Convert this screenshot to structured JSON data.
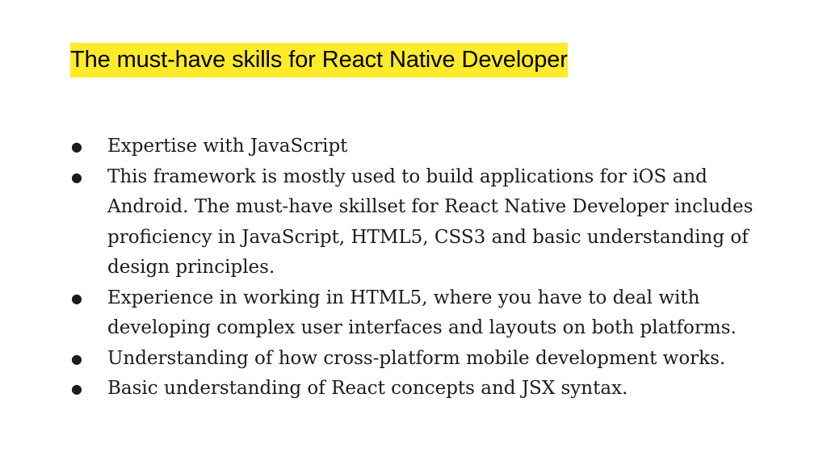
{
  "slide": {
    "title": "The must-have skills for React Native Developer",
    "bullet_symbol": "●",
    "bullets": [
      "Expertise with JavaScript",
      "This framework is mostly used to build applications for iOS and Android. The must-have skillset for React Native Developer includes proficiency in JavaScript, HTML5, CSS3 and basic understanding of design principles.",
      "Experience in working in HTML5, where you have to deal with developing complex user interfaces and layouts on both platforms.",
      "Understanding of how cross-platform mobile development works.",
      "Basic understanding of React concepts and JSX syntax."
    ]
  },
  "colors": {
    "title_highlight": "#ffeb2a",
    "text": "#1c1c1c",
    "background": "#ffffff"
  }
}
